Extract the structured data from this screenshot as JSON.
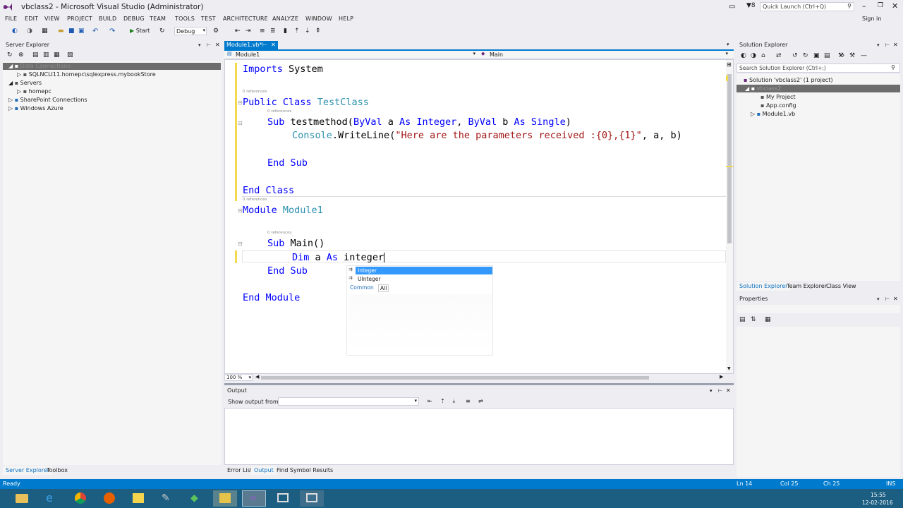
{
  "window": {
    "title": "vbclass2 - Microsoft Visual Studio (Administrator)",
    "quick_launch_placeholder": "Quick Launch (Ctrl+Q)",
    "signin": "Sign in",
    "notif_count": "8"
  },
  "menu": [
    "FILE",
    "EDIT",
    "VIEW",
    "PROJECT",
    "BUILD",
    "DEBUG",
    "TEAM",
    "TOOLS",
    "TEST",
    "ARCHITECTURE",
    "ANALYZE",
    "WINDOW",
    "HELP"
  ],
  "toolbar": {
    "start_label": "Start",
    "config": "Debug"
  },
  "server_explorer": {
    "title": "Server Explorer",
    "items": [
      {
        "label": "Data Connections",
        "selected": true
      },
      {
        "label": "SQLNCLI11.homepc\\sqlexpress.mybookStore"
      },
      {
        "label": "Servers"
      },
      {
        "label": "homepc"
      },
      {
        "label": "SharePoint Connections"
      },
      {
        "label": "Windows Azure"
      }
    ],
    "bottom_tabs": [
      "Server Explorer",
      "Toolbox"
    ]
  },
  "editor": {
    "tab_label": "Module1.vb*",
    "nav_left": "Module1",
    "nav_right": "Main",
    "zoom": "100 %",
    "refs": "0 references",
    "lines": {
      "l1_kw": "Imports",
      "l1_rest": " System",
      "l2_kw": "Public Class",
      "l2_ty": "TestClass",
      "l3_kw1": "Sub",
      "l3_name": "testmethod(",
      "l3_kw2": "ByVal",
      "l3_a": " a ",
      "l3_kw3": "As Integer",
      "l3_c": ", ",
      "l3_kw4": "ByVal",
      "l3_b": " b ",
      "l3_kw5": "As Single",
      "l3_end": ")",
      "l4_ty": "Console",
      "l4_mid": ".WriteLine(",
      "l4_str": "\"Here are the parameters received :{0},{1}\"",
      "l4_end": ", a, b)",
      "l5_kw": "End Sub",
      "l6_kw": "End Class",
      "l7_kw": "Module",
      "l7_ty": "Module1",
      "l8_kw": "Sub",
      "l8_rest": " Main()",
      "l9_kw1": "Dim",
      "l9_a": " a ",
      "l9_kw2": "As",
      "l9_rest": " integer",
      "l10_kw": "End Sub",
      "l11_kw": "End Module"
    }
  },
  "intellisense": {
    "items": [
      "Integer",
      "UInteger"
    ],
    "tabs": [
      "Common",
      "All"
    ]
  },
  "solution_explorer": {
    "title": "Solution Explorer",
    "search_placeholder": "Search Solution Explorer (Ctrl+;)",
    "items": [
      {
        "label": "Solution 'vbclass2' (1 project)"
      },
      {
        "label": "vbclass2",
        "selected": true
      },
      {
        "label": "My Project"
      },
      {
        "label": "App.config"
      },
      {
        "label": "Module1.vb"
      }
    ],
    "tabs": [
      "Solution Explorer",
      "Team Explorer",
      "Class View"
    ]
  },
  "properties": {
    "title": "Properties"
  },
  "output": {
    "title": "Output",
    "show_from_label": "Show output from:",
    "tabs": [
      "Error List",
      "Output",
      "Find Symbol Results"
    ]
  },
  "status": {
    "ready": "Ready",
    "ln": "Ln 14",
    "col": "Col 25",
    "ch": "Ch 25",
    "mode": "INS"
  },
  "taskbar": {
    "time": "15:55",
    "date": "12-02-2016"
  },
  "colors": {
    "accent": "#007acc",
    "keyword": "#0000ff",
    "type": "#2b91af",
    "string": "#a31515",
    "selection": "#3399ff"
  }
}
